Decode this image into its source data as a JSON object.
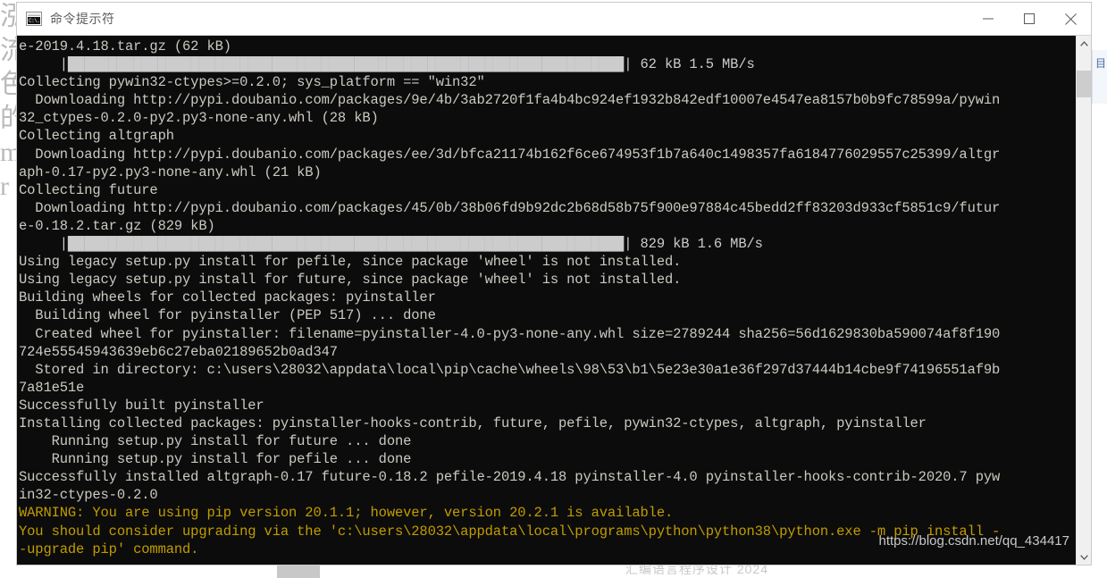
{
  "window": {
    "title": "命令提示符",
    "icon": "cmd-icon",
    "icon_text": "C:\\.",
    "controls": {
      "minimize": "minimize-icon",
      "maximize": "maximize-icon",
      "close": "close-icon"
    }
  },
  "desktop": {
    "ghost_glyphs": [
      "泓",
      "流",
      "色",
      "的",
      "m",
      "r"
    ],
    "bottom_text": "汇编语言程序设计 2024",
    "side_panel_glyph": "目"
  },
  "scrollbar": {
    "up_arrow": "chevron-up-icon",
    "down_arrow": "chevron-down-icon"
  },
  "watermark": "https://blog.csdn.net/qq_434417",
  "console": {
    "progress_bar_full": "|████████████████████████████████████████████████████████████████████████████████|",
    "lines": [
      {
        "text": "e-2019.4.18.tar.gz (62 kB)",
        "style": "normal"
      },
      {
        "text": "     |████████████████████████████████████████████████████████████████████| 62 kB 1.5 MB/s",
        "style": "bar"
      },
      {
        "text": "Collecting pywin32-ctypes>=0.2.0; sys_platform == \"win32\"",
        "style": "normal"
      },
      {
        "text": "  Downloading http://pypi.doubanio.com/packages/9e/4b/3ab2720f1fa4b4bc924ef1932b842edf10007e4547ea8157b0b9fc78599a/pywin",
        "style": "normal"
      },
      {
        "text": "32_ctypes-0.2.0-py2.py3-none-any.whl (28 kB)",
        "style": "normal"
      },
      {
        "text": "Collecting altgraph",
        "style": "normal"
      },
      {
        "text": "  Downloading http://pypi.doubanio.com/packages/ee/3d/bfca21174b162f6ce674953f1b7a640c1498357fa6184776029557c25399/altgr",
        "style": "normal"
      },
      {
        "text": "aph-0.17-py2.py3-none-any.whl (21 kB)",
        "style": "normal"
      },
      {
        "text": "Collecting future",
        "style": "normal"
      },
      {
        "text": "  Downloading http://pypi.doubanio.com/packages/45/0b/38b06fd9b92dc2b68d58b75f900e97884c45bedd2ff83203d933cf5851c9/futur",
        "style": "normal"
      },
      {
        "text": "e-0.18.2.tar.gz (829 kB)",
        "style": "normal"
      },
      {
        "text": "     |████████████████████████████████████████████████████████████████████| 829 kB 1.6 MB/s",
        "style": "bar"
      },
      {
        "text": "Using legacy setup.py install for pefile, since package 'wheel' is not installed.",
        "style": "normal"
      },
      {
        "text": "Using legacy setup.py install for future, since package 'wheel' is not installed.",
        "style": "normal"
      },
      {
        "text": "Building wheels for collected packages: pyinstaller",
        "style": "normal"
      },
      {
        "text": "  Building wheel for pyinstaller (PEP 517) ... done",
        "style": "normal"
      },
      {
        "text": "  Created wheel for pyinstaller: filename=pyinstaller-4.0-py3-none-any.whl size=2789244 sha256=56d1629830ba590074af8f190",
        "style": "normal"
      },
      {
        "text": "724e55545943639eb6c27eba02189652b0ad347",
        "style": "normal"
      },
      {
        "text": "  Stored in directory: c:\\users\\28032\\appdata\\local\\pip\\cache\\wheels\\98\\53\\b1\\5e23e30a1e36f297d37444b14cbe9f74196551af9b",
        "style": "normal"
      },
      {
        "text": "7a81e51e",
        "style": "normal"
      },
      {
        "text": "Successfully built pyinstaller",
        "style": "normal"
      },
      {
        "text": "Installing collected packages: pyinstaller-hooks-contrib, future, pefile, pywin32-ctypes, altgraph, pyinstaller",
        "style": "normal"
      },
      {
        "text": "    Running setup.py install for future ... done",
        "style": "normal"
      },
      {
        "text": "    Running setup.py install for pefile ... done",
        "style": "normal"
      },
      {
        "text": "Successfully installed altgraph-0.17 future-0.18.2 pefile-2019.4.18 pyinstaller-4.0 pyinstaller-hooks-contrib-2020.7 pyw",
        "style": "normal"
      },
      {
        "text": "in32-ctypes-0.2.0",
        "style": "normal"
      },
      {
        "text": "WARNING: You are using pip version 20.1.1; however, version 20.2.1 is available.",
        "style": "warn"
      },
      {
        "text": "You should consider upgrading via the 'c:\\users\\28032\\appdata\\local\\programs\\python\\python38\\python.exe -m pip install -",
        "style": "warn"
      },
      {
        "text": "-upgrade pip' command.",
        "style": "warn"
      }
    ]
  },
  "colors": {
    "console_bg": "#0c0c0c",
    "console_fg": "#ccc9c1",
    "warning_fg": "#c19c00",
    "titlebar_bg": "#ffffff",
    "scrollbar_bg": "#f0f0f0"
  }
}
